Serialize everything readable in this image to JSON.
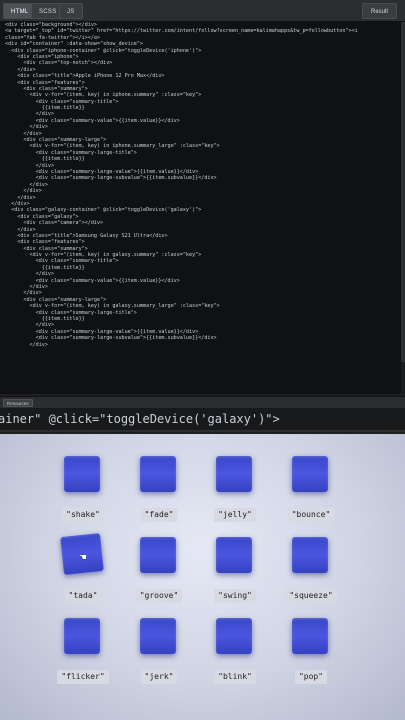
{
  "tabs": [
    {
      "label": "HTML"
    },
    {
      "label": "SCSS"
    },
    {
      "label": "JS"
    }
  ],
  "result_button": "Result",
  "resources_button": "Resources",
  "code_lines": [
    "<div class=\"background\"></div>",
    "<a target=\"_top\" id=\"twitter\" href=\"https://twitter.com/intent/follow?screen_name=kalimahapps&tw_p=followbutton\"><i",
    "class=\"fab fa-twitter\"></i></a>",
    "<div id=\"container\" :data-show=\"show_device\">",
    "  <div class=\"iphone-container\" @click=\"toggleDevice('iphone')\">",
    "    <div class=\"iphone\">",
    "      <div class=\"top-notch\"></div>",
    "    </div>",
    "    <div class=\"title\">Apple iPhone 12 Pro Max</div>",
    "    <div class=\"features\">",
    "      <div class=\"summary\">",
    "        <div v-for=\"(item, key) in iphone.summary\" :class=\"key\">",
    "          <div class=\"summary-title\">",
    "            {{item.title}}",
    "          </div>",
    "          <div class=\"summary-value\">{{item.value}}</div>",
    "        </div>",
    "      </div>",
    "      <div class=\"summary-large\">",
    "        <div v-for=\"(item, key) in iphone.summary_large\" :class=\"key\">",
    "          <div class=\"summary-large-title\">",
    "            {{item.title}}",
    "          </div>",
    "          <div class=\"summary-large-value\">{{item.value}}</div>",
    "          <div class=\"summary-large-subvalue\">{{item.subvalue}}</div>",
    "        </div>",
    "      </div>",
    "    </div>",
    "  </div>",
    "  <div class=\"galaxy-container\" @click=\"toggleDevice('galaxy')\">",
    "    <div class=\"galaxy\">",
    "      <div class=\"camera\"></div>",
    "    </div>",
    "    <div class=\"title\">Samsung Galaxy S21 Ultra</div>",
    "    <div class=\"features\">",
    "      <div class=\"summary\">",
    "        <div v-for=\"(item, key) in galaxy.summary\" :class=\"key\">",
    "          <div class=\"summary-title\">",
    "            {{item.title}}",
    "          </div>",
    "          <div class=\"summary-value\">{{item.value}}</div>",
    "        </div>",
    "      </div>",
    "      <div class=\"summary-large\">",
    "        <div v-for=\"(item, key) in galaxy.summary_large\" :class=\"key\">",
    "          <div class=\"summary-large-title\">",
    "            {{item.title}}",
    "          </div>",
    "          <div class=\"summary-large-value\">{{item.value}}</div>",
    "          <div class=\"summary-large-subvalue\">{{item.subvalue}}</div>",
    "        </div>"
  ],
  "zoom_code": "ainer\" @click=\"toggleDevice('galaxy')\">",
  "animations": [
    {
      "label": "\"shake\""
    },
    {
      "label": "\"fade\""
    },
    {
      "label": "\"jelly\""
    },
    {
      "label": "\"bounce\""
    },
    {
      "label": "\"tada\""
    },
    {
      "label": "\"groove\""
    },
    {
      "label": "\"swing\""
    },
    {
      "label": "\"squeeze\""
    },
    {
      "label": "\"flicker\""
    },
    {
      "label": "\"jerk\""
    },
    {
      "label": "\"blink\""
    },
    {
      "label": "\"pop\""
    }
  ],
  "colors": {
    "square": "#4150d8",
    "result_bg": "#d5d9e8",
    "editor_bg": "#0f1113"
  },
  "icons": {
    "cursor": "hand-pointer-icon"
  }
}
